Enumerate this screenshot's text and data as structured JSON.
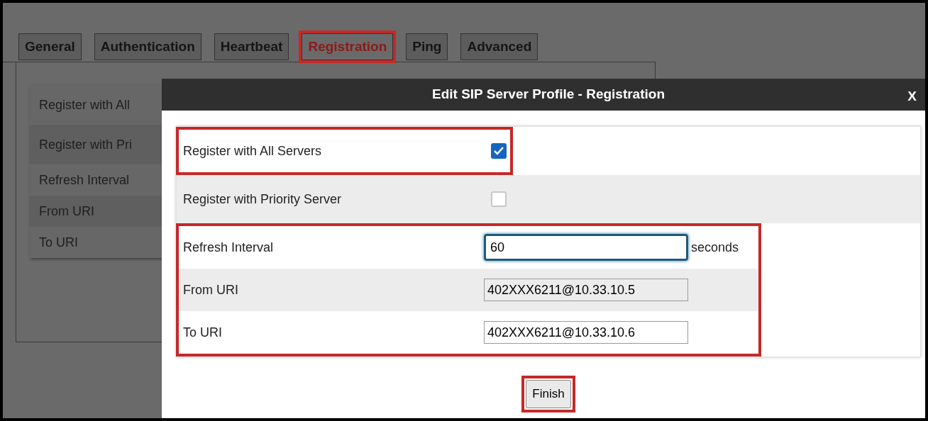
{
  "tabs": [
    {
      "label": "General",
      "selected": false,
      "highlighted": false
    },
    {
      "label": "Authentication",
      "selected": false,
      "highlighted": false
    },
    {
      "label": "Heartbeat",
      "selected": false,
      "highlighted": false
    },
    {
      "label": "Registration",
      "selected": true,
      "highlighted": true
    },
    {
      "label": "Ping",
      "selected": false,
      "highlighted": false
    },
    {
      "label": "Advanced",
      "selected": false,
      "highlighted": false
    }
  ],
  "background_rows": [
    "Register with All",
    "Register with Pri",
    "Refresh Interval",
    "From URI",
    "To URI"
  ],
  "dialog": {
    "title": "Edit SIP Server Profile - Registration",
    "close": "X",
    "sections": [
      {
        "highlighted": true,
        "rows": [
          {
            "kind": "checkbox",
            "label": "Register with All Servers",
            "checked": true
          }
        ]
      },
      {
        "highlighted": false,
        "rows": [
          {
            "kind": "checkbox",
            "label": "Register with Priority Server",
            "checked": false
          }
        ]
      },
      {
        "highlighted": true,
        "rows": [
          {
            "kind": "input",
            "label": "Refresh Interval",
            "value": "60",
            "focused": true,
            "unit": "seconds"
          },
          {
            "kind": "input",
            "label": "From URI",
            "value": "402XXX6211@10.33.10.5",
            "focused": false
          },
          {
            "kind": "input",
            "label": "To URI",
            "value": "402XXX6211@10.33.10.6",
            "focused": false
          }
        ]
      }
    ],
    "button": {
      "label": "Finish",
      "highlighted": true
    }
  }
}
